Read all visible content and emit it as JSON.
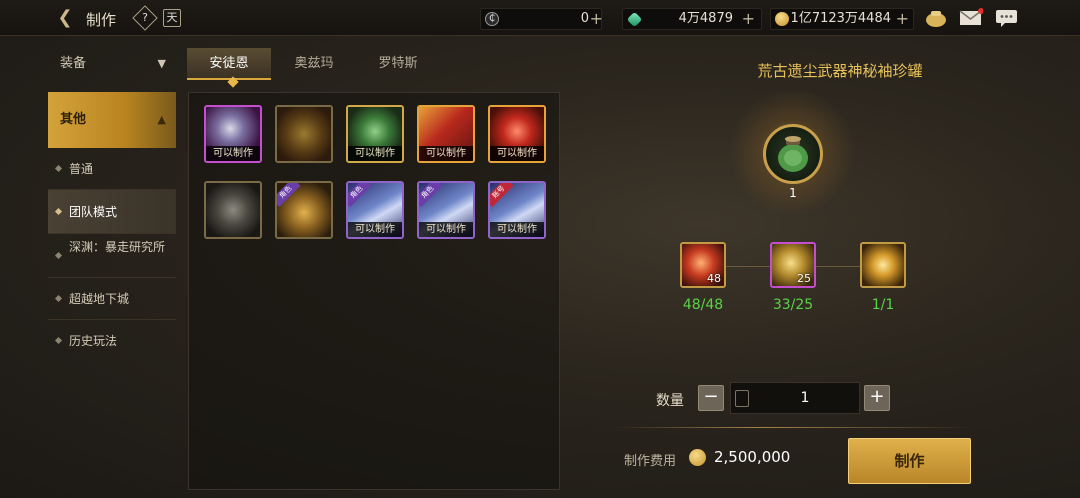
{
  "header": {
    "title": "制作",
    "help_glyph": "?",
    "calendar_glyph": "天",
    "currencies": [
      {
        "icon": "coin-c-icon",
        "value": "0"
      },
      {
        "icon": "green-crystal-icon",
        "value": "4万4879"
      },
      {
        "icon": "gold-coin-icon",
        "value": "1亿7123万4484"
      }
    ]
  },
  "sidebar": {
    "equip_label": "装备",
    "other_label": "其他",
    "items": [
      {
        "label": "普通"
      },
      {
        "label": "团队模式"
      },
      {
        "label": "深渊：暴走研究所"
      },
      {
        "label": "超越地下城"
      },
      {
        "label": "历史玩法"
      }
    ]
  },
  "tabs": [
    {
      "label": "安徒恩"
    },
    {
      "label": "奥兹玛"
    },
    {
      "label": "罗特斯"
    }
  ],
  "grid": {
    "craftable_label": "可以制作",
    "corner_role": "角色",
    "corner_account": "账号"
  },
  "detail": {
    "title": "荒古遗尘武器神秘袖珍罐",
    "main_count": "1",
    "materials": [
      {
        "count": "48",
        "have": "48/48"
      },
      {
        "count": "25",
        "have": "33/25"
      },
      {
        "count": "",
        "have": "1/1"
      }
    ],
    "qty_label": "数量",
    "minus": "−",
    "plus": "+",
    "qty_value": "1",
    "cost_label": "制作费用",
    "cost_value": "2,500,000",
    "make_label": "制作"
  },
  "colors": {
    "accent": "#d9a93d",
    "have_ok": "#5ad24a",
    "title_gold": "#e7c15a"
  }
}
